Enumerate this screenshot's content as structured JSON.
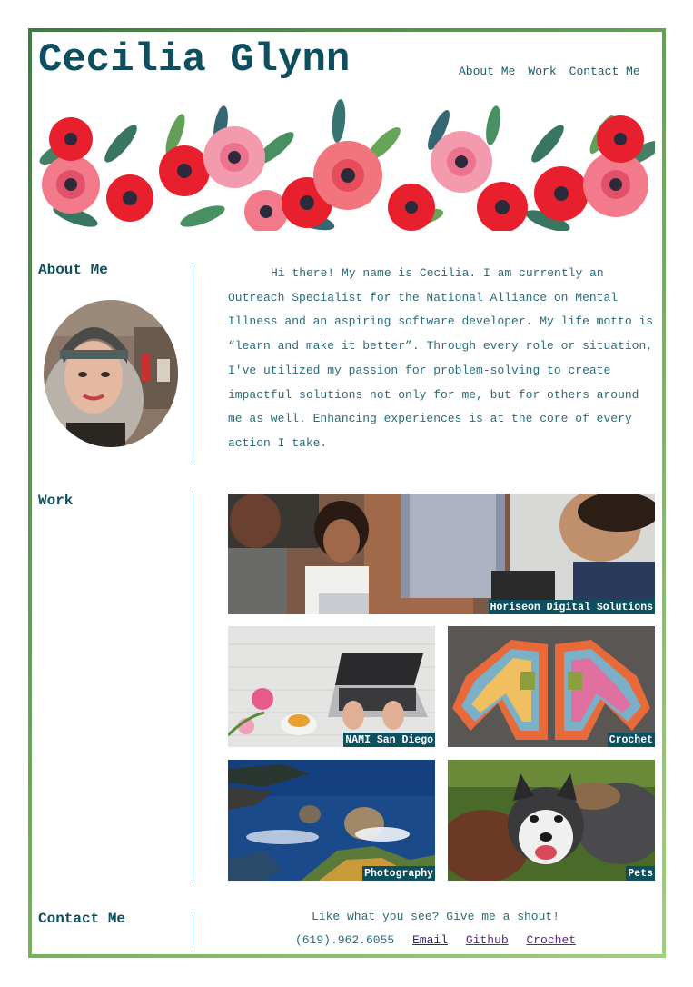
{
  "header": {
    "name": "Cecilia Glynn",
    "nav": [
      "About Me",
      "Work",
      "Contact Me"
    ]
  },
  "about": {
    "heading": "About Me",
    "text": "Hi there! My name is Cecilia. I am currently an Outreach Specialist for the National Alliance on Mental Illness and an aspiring software developer. My life motto is “learn and make it better”. Through every role or situation, I've utilized my passion for problem-solving to create impactful solutions not only for me, but for others around me as well. Enhancing experiences is at the core of every action I take."
  },
  "work": {
    "heading": "Work",
    "tiles": [
      {
        "label": "Horiseon Digital Solutions",
        "icon": "team-meeting-photo"
      },
      {
        "label": "NAMI San Diego",
        "icon": "laptop-desk-photo"
      },
      {
        "label": "Crochet",
        "icon": "crochet-sweater-photo"
      },
      {
        "label": "Photography",
        "icon": "coastline-photo"
      },
      {
        "label": "Pets",
        "icon": "husky-dog-photo"
      }
    ]
  },
  "contact": {
    "heading": "Contact Me",
    "tagline": "Like what you see? Give me a shout!",
    "phone": "(619).962.6055",
    "links": [
      "Email",
      "Github",
      "Crochet"
    ]
  },
  "colors": {
    "accent": "#0d4f5e",
    "border_start": "#3e7a44",
    "border_end": "#9fd07e",
    "link": "#5a2a82"
  }
}
